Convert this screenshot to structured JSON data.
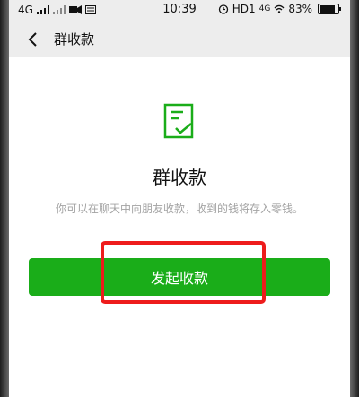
{
  "status_bar": {
    "network": "4G",
    "time": "10:39",
    "hd_label": "HD1",
    "volte": "4G",
    "battery_percent_text": "83%",
    "battery_level": 0.83
  },
  "header": {
    "back_icon": "chevron-left-icon",
    "title": "群收款"
  },
  "main": {
    "icon": "receipt-check-icon",
    "title": "群收款",
    "description": "你可以在聊天中向朋友收款，收到的钱将存入零钱。",
    "button_label": "发起收款"
  },
  "colors": {
    "accent_green": "#1aad19",
    "highlight_red": "#ee1c1c",
    "background": "#ededed"
  }
}
